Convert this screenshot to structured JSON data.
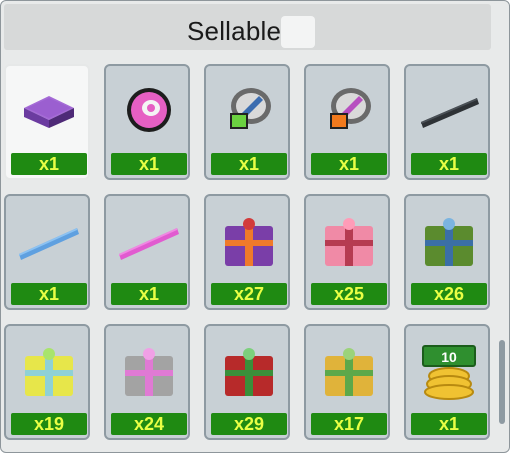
{
  "header": {
    "title": "Sellable"
  },
  "items": [
    {
      "name": "purple-cushion-icon",
      "count": "x1",
      "selected": true
    },
    {
      "name": "pink-disc-icon",
      "count": "x1"
    },
    {
      "name": "green-feather-badge-icon",
      "count": "x1"
    },
    {
      "name": "orange-feather-badge-icon",
      "count": "x1"
    },
    {
      "name": "dark-bar-icon",
      "count": "x1"
    },
    {
      "name": "blue-bar-icon",
      "count": "x1"
    },
    {
      "name": "pink-bar-icon",
      "count": "x1"
    },
    {
      "name": "purple-gift-icon",
      "count": "x27"
    },
    {
      "name": "pink-gift-icon",
      "count": "x25"
    },
    {
      "name": "green-gift-icon",
      "count": "x26"
    },
    {
      "name": "yellow-gift-icon",
      "count": "x19"
    },
    {
      "name": "grey-gift-icon",
      "count": "x24"
    },
    {
      "name": "red-gift-icon",
      "count": "x29"
    },
    {
      "name": "gold-gift-icon",
      "count": "x17"
    },
    {
      "name": "ten-coin-stack-icon",
      "count": "x1",
      "label": "10"
    }
  ],
  "colors": {
    "badge": "#1f8a12",
    "badge_text": "#e9ff45"
  }
}
